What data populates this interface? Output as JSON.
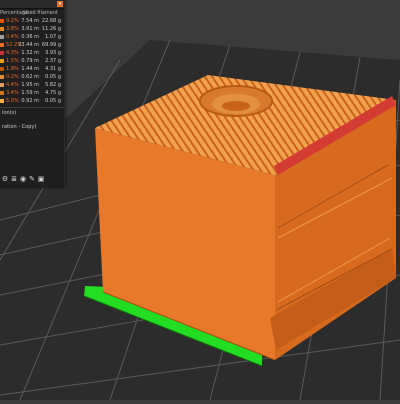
{
  "legend": {
    "columns": [
      "Percentage",
      "Used filament"
    ],
    "rows": [
      {
        "color": "#ff4d00",
        "pct": "9.2%",
        "length": "7.54 m",
        "weight": "22.68 g"
      },
      {
        "color": "#ed8b21",
        "pct": "3.8%",
        "length": "3.91 m",
        "weight": "11.26 g"
      },
      {
        "color": "#a0a0a0",
        "pct": "0.4%",
        "length": "0.36 m",
        "weight": "1.07 g"
      },
      {
        "color": "#ed6b21",
        "pct": "52.2%",
        "length": "23.44 m",
        "weight": "69.99 g"
      },
      {
        "color": "#cc3333",
        "pct": "4.3%",
        "length": "1.32 m",
        "weight": "3.93 g"
      },
      {
        "color": "#f0a000",
        "pct": "1.5%",
        "length": "0.79 m",
        "weight": "2.37 g"
      },
      {
        "color": "#c05a00",
        "pct": "1.9%",
        "length": "1.44 m",
        "weight": "4.31 g"
      },
      {
        "color": "#d98c40",
        "pct": "0.2%",
        "length": "0.62 m",
        "weight": "0.05 g"
      },
      {
        "color": "#e0a060",
        "pct": "4.4%",
        "length": "1.95 m",
        "weight": "5.82 g"
      },
      {
        "color": "#cc7722",
        "pct": "3.4%",
        "length": "1.59 m",
        "weight": "4.75 g"
      },
      {
        "color": "#ffb040",
        "pct": "5.0%",
        "length": "0.92 m",
        "weight": "0.05 g"
      }
    ],
    "extra": [
      "Ion(s)",
      "",
      "ration - Copy)"
    ],
    "icons": [
      "gear-icon",
      "layers-icon",
      "eye-icon",
      "tool-icon",
      "cube-icon"
    ]
  },
  "viewport": {
    "bed_color": "#2c2c2c",
    "grid_color": "#6a6a6a",
    "model_color": "#e8782a",
    "top_color": "#f3a04a",
    "accent_red": "#d43c33",
    "support_green": "#22dd22"
  }
}
